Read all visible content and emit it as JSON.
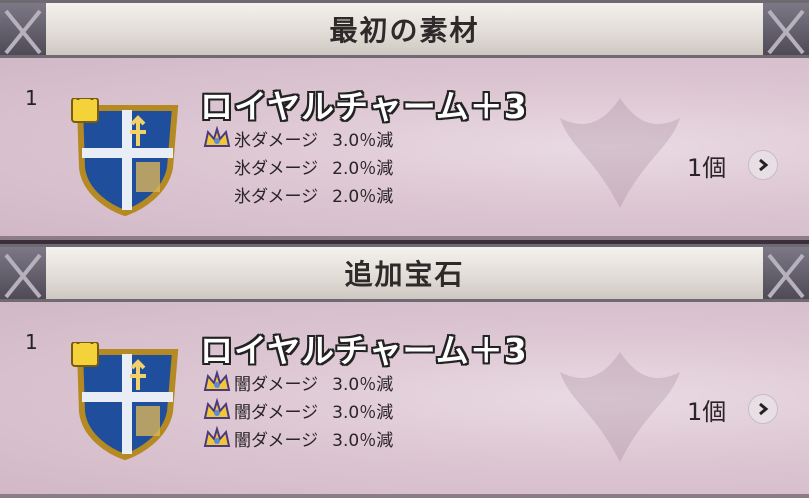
{
  "sections": [
    {
      "title": "最初の素材",
      "item": {
        "index": "1",
        "name": "ロイヤルチャーム＋3",
        "effects": [
          {
            "crown": true,
            "text": "氷ダメージ",
            "value": "3.0％減"
          },
          {
            "crown": false,
            "text": "氷ダメージ",
            "value": "2.0％減"
          },
          {
            "crown": false,
            "text": "氷ダメージ",
            "value": "2.0％減"
          }
        ],
        "count": "1個"
      }
    },
    {
      "title": "追加宝石",
      "item": {
        "index": "1",
        "name": "ロイヤルチャーム＋3",
        "effects": [
          {
            "crown": true,
            "text": "闇ダメージ",
            "value": "3.0％減"
          },
          {
            "crown": true,
            "text": "闇ダメージ",
            "value": "3.0％減"
          },
          {
            "crown": true,
            "text": "闇ダメージ",
            "value": "3.0％減"
          }
        ],
        "count": "1個"
      }
    }
  ],
  "icons": {
    "shield": "royal-charm-shield-icon",
    "lock": "lock-icon",
    "crown": "crown-icon",
    "arrow": "chevron-right-icon"
  },
  "colors": {
    "header_bg": "#e2ddd8",
    "row_bg": "#ddc7d3",
    "name_fill": "#ffffff",
    "name_outline": "#222222"
  }
}
